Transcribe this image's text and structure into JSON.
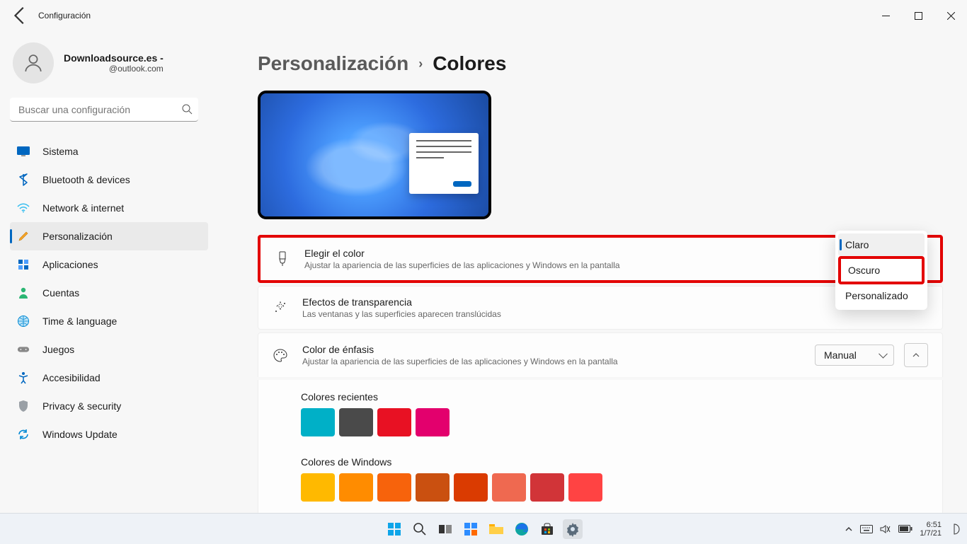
{
  "window": {
    "title": "Configuración"
  },
  "profile": {
    "name": "Downloadsource.es -",
    "email": "@outlook.com"
  },
  "search": {
    "placeholder": "Buscar una configuración"
  },
  "nav": {
    "items": [
      {
        "label": "Sistema"
      },
      {
        "label": "Bluetooth & devices"
      },
      {
        "label": "Network & internet"
      },
      {
        "label": "Personalización"
      },
      {
        "label": "Aplicaciones"
      },
      {
        "label": "Cuentas"
      },
      {
        "label": "Time & language"
      },
      {
        "label": "Juegos"
      },
      {
        "label": "Accesibilidad"
      },
      {
        "label": "Privacy & security"
      },
      {
        "label": "Windows Update"
      }
    ]
  },
  "breadcrumb": {
    "parent": "Personalización",
    "current": "Colores"
  },
  "cards": {
    "choose": {
      "title": "Elegir el color",
      "desc": "Ajustar la apariencia de las superficies de las aplicaciones y Windows en la pantalla",
      "dropdown": {
        "opt1": "Claro",
        "opt2": "Oscuro",
        "opt3": "Personalizado"
      }
    },
    "transparency": {
      "title": "Efectos de transparencia",
      "desc": "Las ventanas y las superficies aparecen translúcidas"
    },
    "accent": {
      "title": "Color de énfasis",
      "desc": "Ajustar la apariencia de las superficies de las aplicaciones y Windows en la pantalla",
      "mode": "Manual",
      "recent_label": "Colores recientes",
      "win_label": "Colores de Windows"
    }
  },
  "colors": {
    "recent": [
      "#00b0c7",
      "#4a4a4a",
      "#e81123",
      "#e3006d"
    ],
    "windows": [
      "#ffb900",
      "#ff8c00",
      "#f7630c",
      "#ca5010",
      "#da3b01",
      "#ef6950",
      "#d13438",
      "#ff4343"
    ]
  },
  "tray": {
    "time": "6:51",
    "date": "1/7/21"
  }
}
